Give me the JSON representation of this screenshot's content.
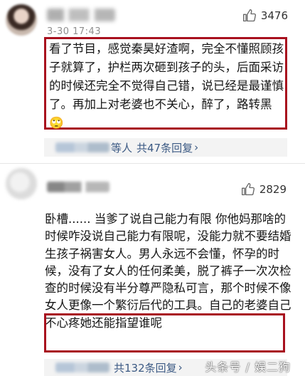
{
  "comments": [
    {
      "timestamp": "3-30 17:43",
      "likes": "3476",
      "text": "看了节目，感觉秦昊好渣啊，完全不懂照顾孩子就算了，护栏两次砸到孩子的头，后面采访的时候还完全不觉得自己错，说已经是最谨慎了。再加上对老婆也不关心，醉了，路转黑🙄",
      "reply_suffix": "等人",
      "reply_count_label": "共47条回复"
    },
    {
      "likes": "2829",
      "text": "卧槽...... 当爹了说自己能力有限 你他妈那啥的时候咋没说自己能力有限呢，没能力就不要结婚生孩子祸害女人。男人永远不会懂，怀孕的时候，没有了女人的任何柔美，脱了裤子一次次检查的时候没有半分尊严隐私可言，那个时候不像女人更像一个繁衍后代的工具。自己的老婆自己不心疼她还能指望谁呢",
      "reply_count_label": "共132条回复"
    }
  ],
  "icons": {
    "like": "thumbs-up-icon",
    "reply_arrow": "chevron-right-icon"
  },
  "colors": {
    "highlight_box": "#a8101e",
    "reply_link": "#3c5a84"
  },
  "watermark": "头条号 / 娱二狗"
}
